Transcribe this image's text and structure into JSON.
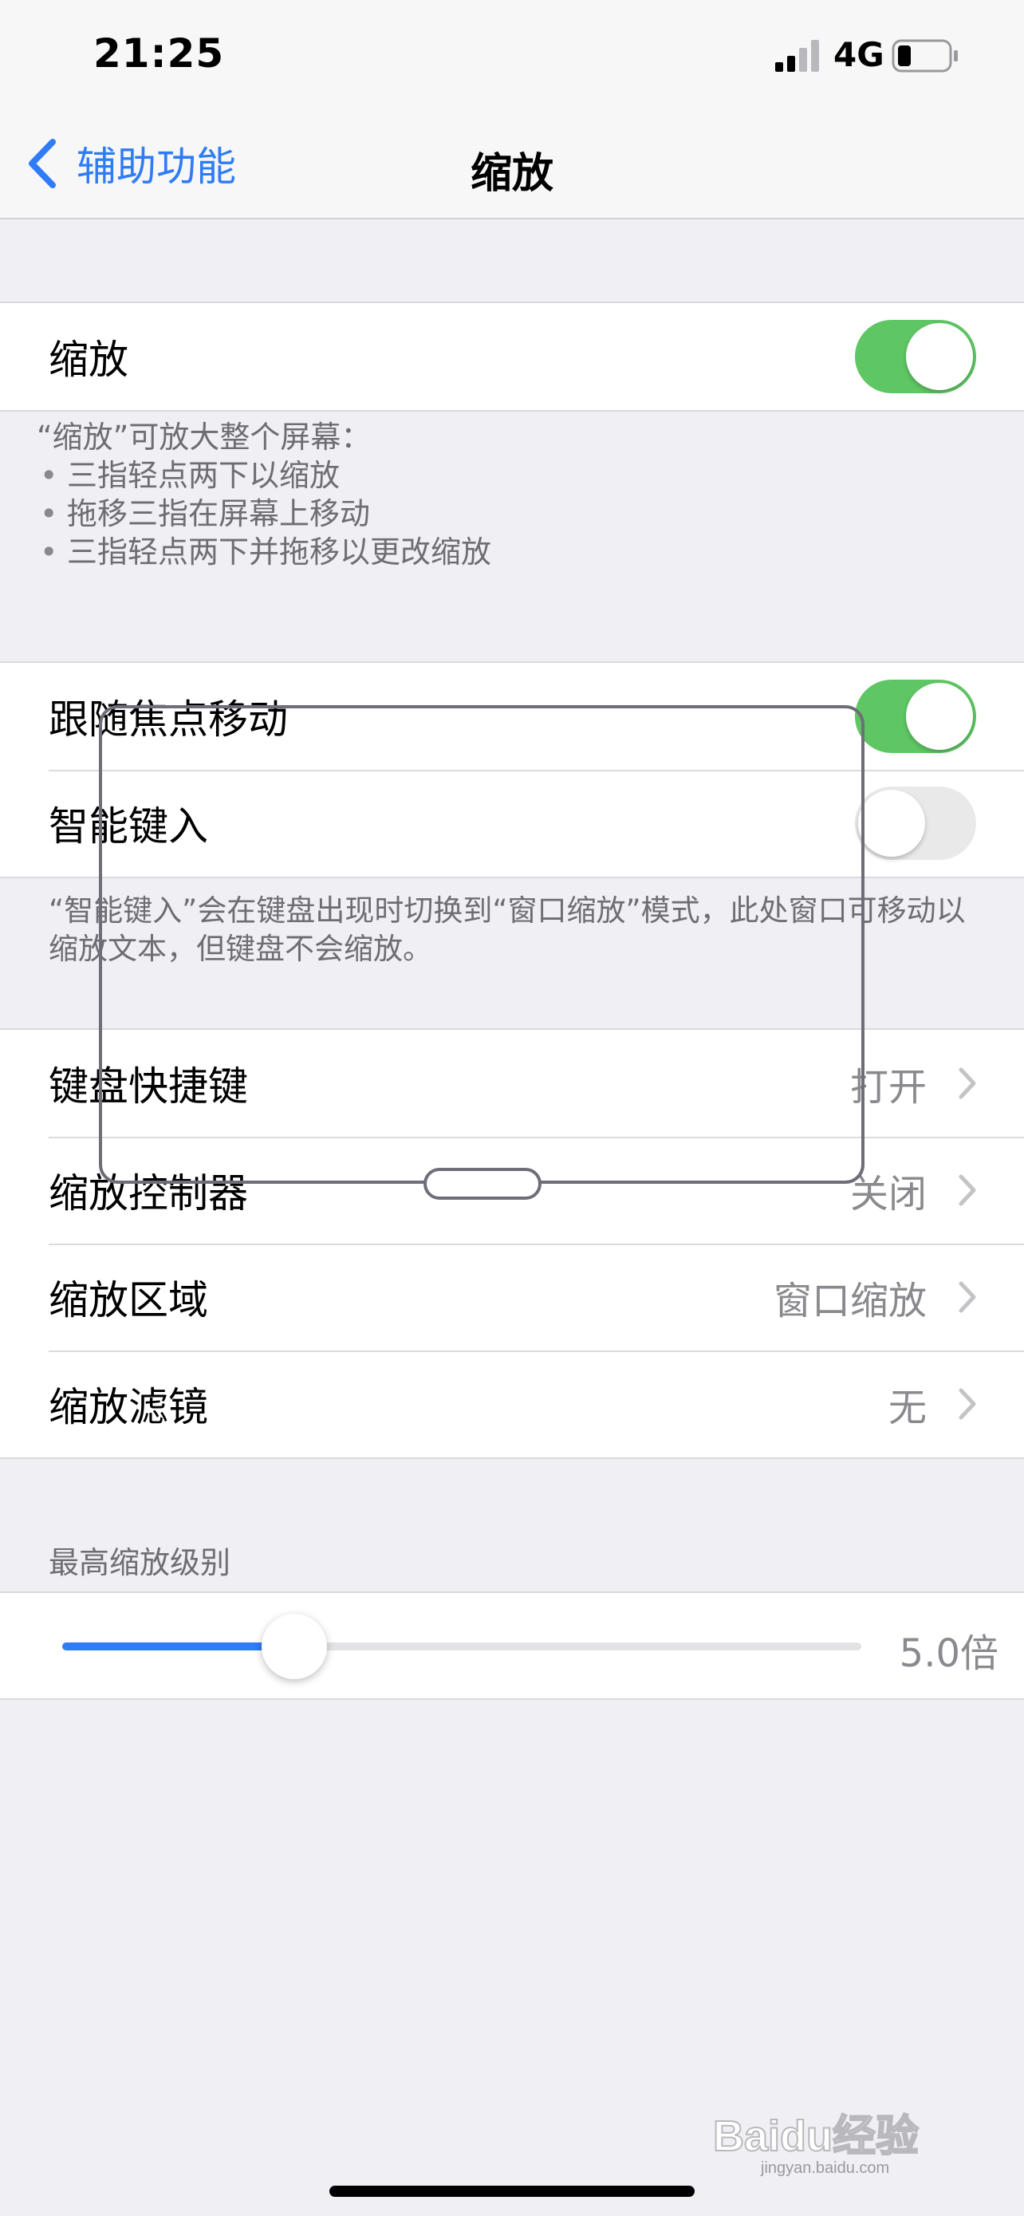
{
  "status_bar": {
    "time": "21:25",
    "network": "4G",
    "signal_icon": "signal-bars-icon",
    "battery_icon": "battery-low-icon"
  },
  "nav": {
    "back_label": "辅助功能",
    "title": "缩放",
    "accent_color": "#2f7cf6"
  },
  "zoom_group": {
    "label": "缩放",
    "enabled": true
  },
  "zoom_note": {
    "intro": "“缩放”可放大整个屏幕：",
    "items": [
      "三指轻点两下以缩放",
      "拖移三指在屏幕上移动",
      "三指轻点两下并拖移以更改缩放"
    ]
  },
  "focus_group": {
    "follow_focus_label": "跟随焦点移动",
    "follow_focus_enabled": true,
    "smart_typing_label": "智能键入",
    "smart_typing_enabled": false
  },
  "smart_typing_note": "“智能键入”会在键盘出现时切换到“窗口缩放”模式，此处窗口可移动以缩放文本，但键盘不会缩放。",
  "options_group": {
    "keyboard_shortcuts": {
      "label": "键盘快捷键",
      "value": "打开"
    },
    "zoom_controller": {
      "label": "缩放控制器",
      "value": "关闭"
    },
    "zoom_region": {
      "label": "缩放区域",
      "value": "窗口缩放"
    },
    "zoom_filter": {
      "label": "缩放滤镜",
      "value": "无"
    }
  },
  "max_zoom": {
    "header": "最高缩放级别",
    "value_label": "5.0倍",
    "slider_fraction": 0.29
  },
  "watermark": {
    "text": "Baidu经验",
    "subtext": "jingyan.baidu.com"
  },
  "colors": {
    "toggle_on": "#5fc664",
    "toggle_off": "#e9e9ea",
    "background": "#efeff4"
  }
}
